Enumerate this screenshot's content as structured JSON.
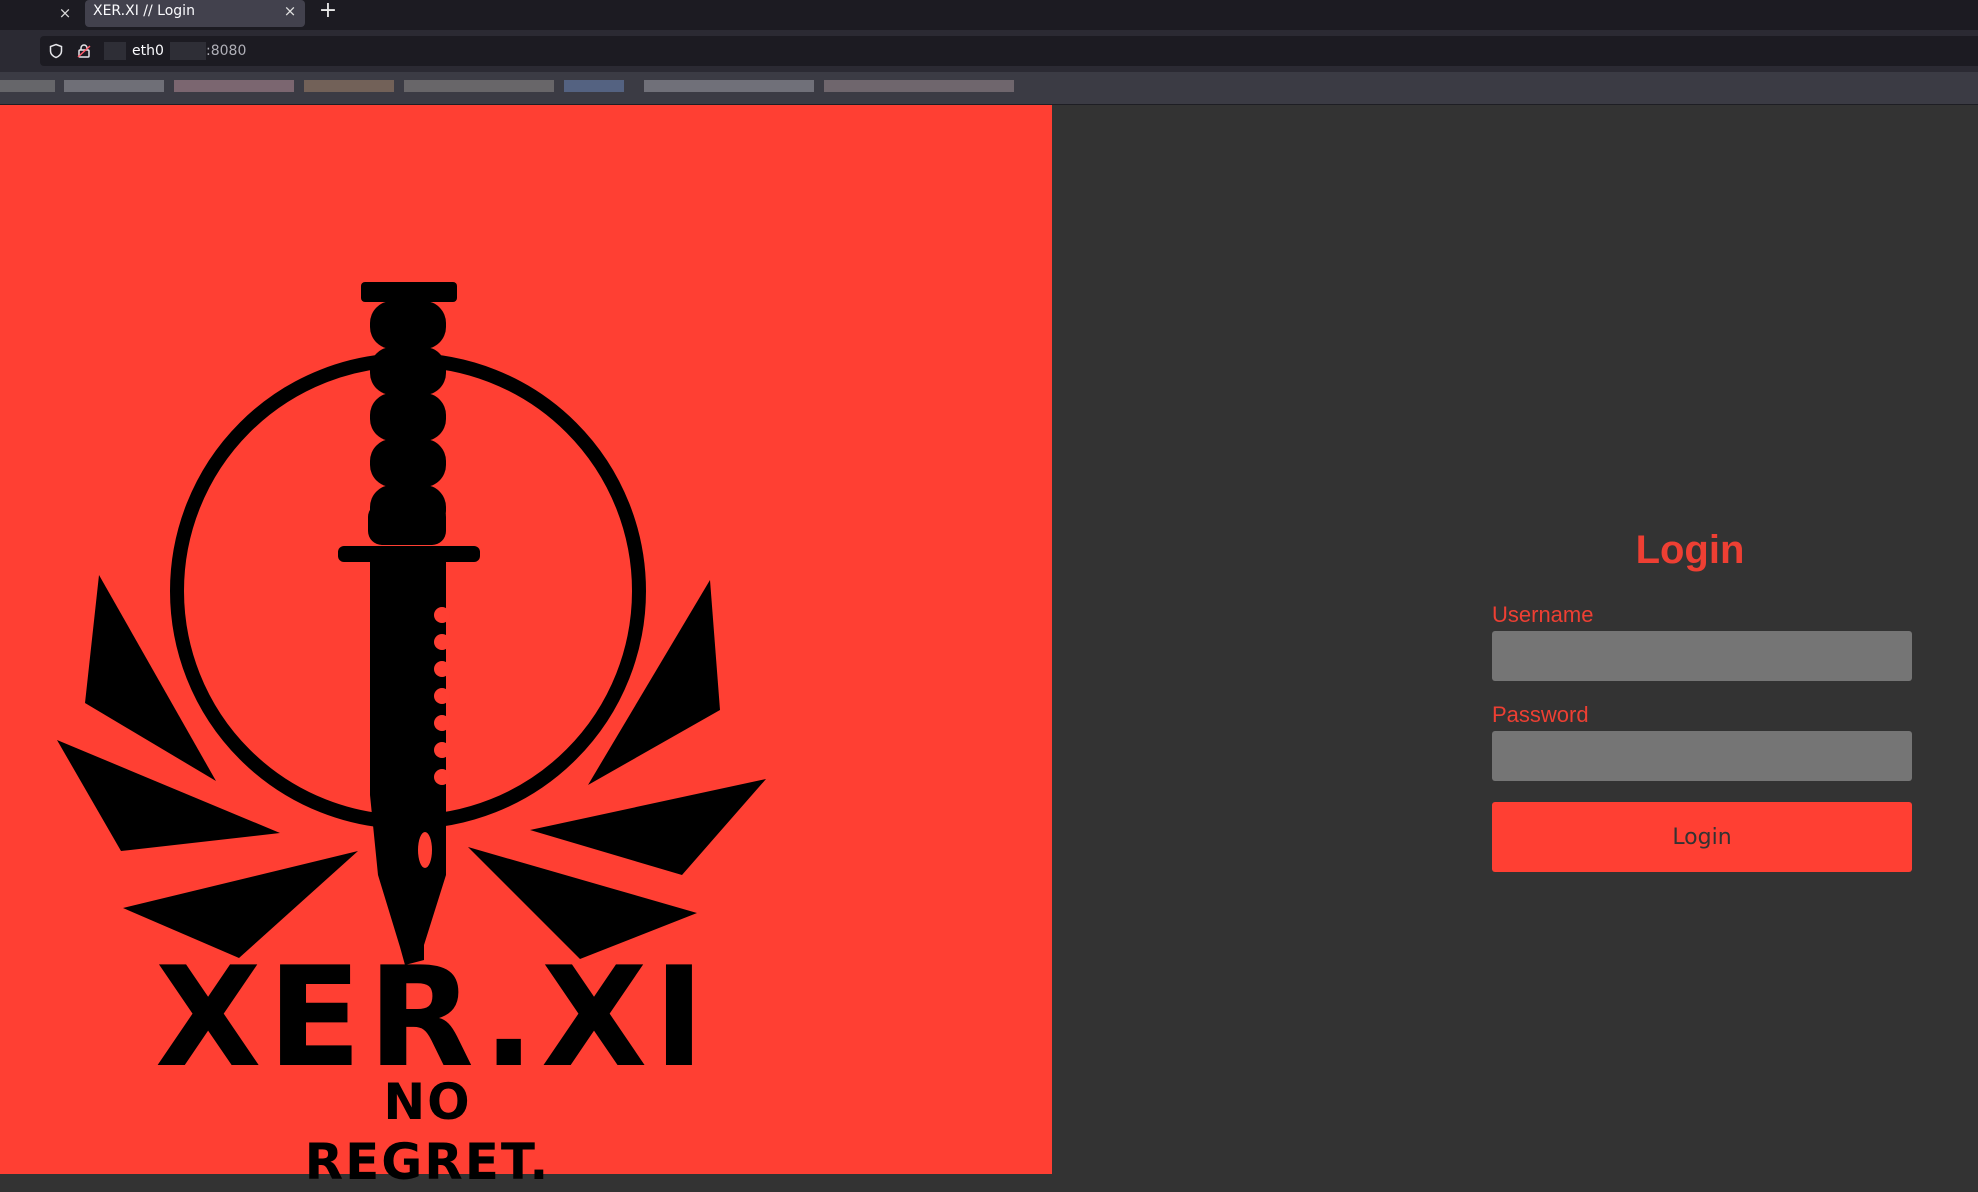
{
  "browser": {
    "tab_title": "XER.XI // Login",
    "tab_close_glyph": "×",
    "new_tab_glyph": "+",
    "url_host": "eth0",
    "url_port": ":8080",
    "icons": [
      "close-icon",
      "shield-icon",
      "lock-icon",
      "plus-icon"
    ]
  },
  "logo": {
    "brand": "XER.XI",
    "tagline": "NO REGRET.",
    "icon": "dagger-emblem-icon"
  },
  "login": {
    "title": "Login",
    "username_label": "Username",
    "username_value": "",
    "password_label": "Password",
    "password_value": "",
    "button_label": "Login"
  },
  "colors": {
    "accent": "#ff3f33",
    "text_accent": "#ee3f33",
    "panel_bg": "#333333",
    "input_bg": "#757575",
    "logo_ink": "#000000"
  }
}
